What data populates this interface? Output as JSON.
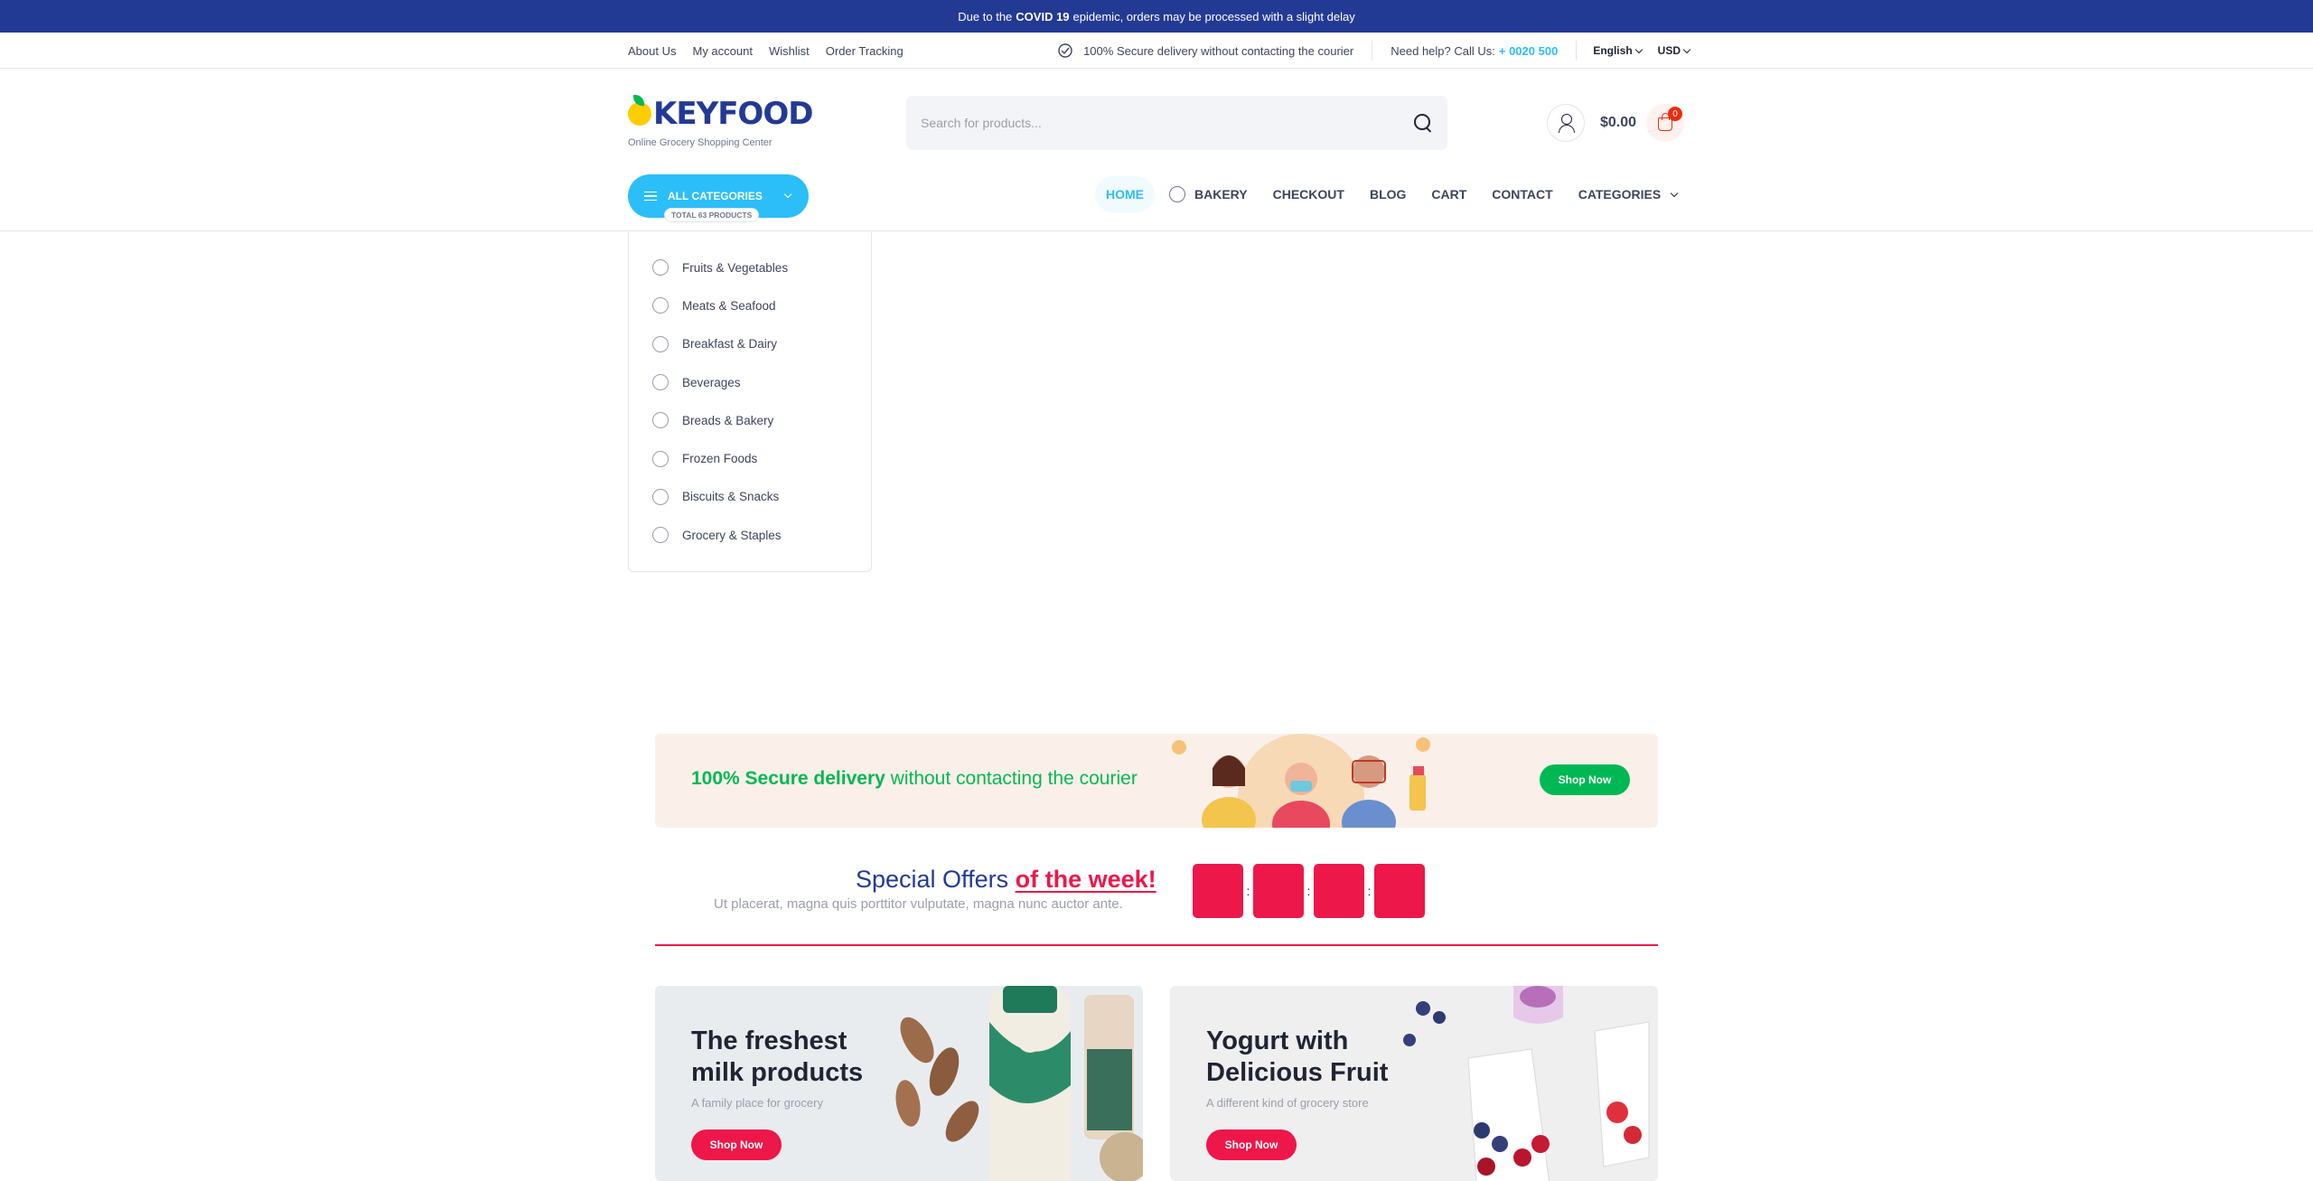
{
  "announcement": {
    "pre": "Due to the",
    "strong": "COVID 19",
    "post": "epidemic, orders may be processed with a slight delay"
  },
  "topbar": {
    "links": [
      "About Us",
      "My account",
      "Wishlist",
      "Order Tracking"
    ],
    "secure_text": "100% Secure delivery without contacting the courier",
    "help_text": "Need help? Call Us:",
    "phone": "+ 0020 500",
    "language": "English",
    "currency": "USD"
  },
  "header": {
    "logo_text": "KEYFOOD",
    "logo_sub": "Online Grocery Shopping Center",
    "search_placeholder": "Search for products...",
    "cart_total": "$0.00",
    "cart_count": "0"
  },
  "categories_button": {
    "label": "ALL CATEGORIES",
    "total": "TOTAL 63 PRODUCTS"
  },
  "nav": {
    "items": [
      {
        "label": "HOME",
        "active": true
      },
      {
        "label": "BAKERY",
        "icon": "bakery-icon"
      },
      {
        "label": "CHECKOUT"
      },
      {
        "label": "BLOG"
      },
      {
        "label": "CART"
      },
      {
        "label": "CONTACT"
      },
      {
        "label": "CATEGORIES",
        "has_dropdown": true
      }
    ]
  },
  "category_panel": {
    "items": [
      {
        "label": "Fruits & Vegetables",
        "icon": "apple-icon"
      },
      {
        "label": "Meats & Seafood",
        "icon": "meat-icon"
      },
      {
        "label": "Breakfast & Dairy",
        "icon": "egg-icon"
      },
      {
        "label": "Beverages",
        "icon": "cup-icon"
      },
      {
        "label": "Breads & Bakery",
        "icon": "bread-icon"
      },
      {
        "label": "Frozen Foods",
        "icon": "snowflake-icon"
      },
      {
        "label": "Biscuits & Snacks",
        "icon": "candy-icon"
      },
      {
        "label": "Grocery & Staples",
        "icon": "grocery-icon"
      }
    ]
  },
  "secure_banner": {
    "strong": "100% Secure delivery",
    "rest": "without contacting the courier",
    "button": "Shop Now"
  },
  "offers": {
    "title": "Special Offers",
    "highlight": "of the week!",
    "subtitle": "Ut placerat, magna quis porttitor vulputate, magna nunc auctor ante."
  },
  "promo_cards": [
    {
      "title": "The freshest milk products",
      "subtitle": "A family place for grocery",
      "button": "Shop Now"
    },
    {
      "title": "Yogurt with Delicious Fruit",
      "subtitle": "A different kind of grocery store",
      "button": "Shop Now"
    }
  ],
  "colors": {
    "primary_blue": "#2bbef9",
    "dark_blue": "#233a95",
    "green": "#00b853",
    "red": "#ed174a"
  }
}
